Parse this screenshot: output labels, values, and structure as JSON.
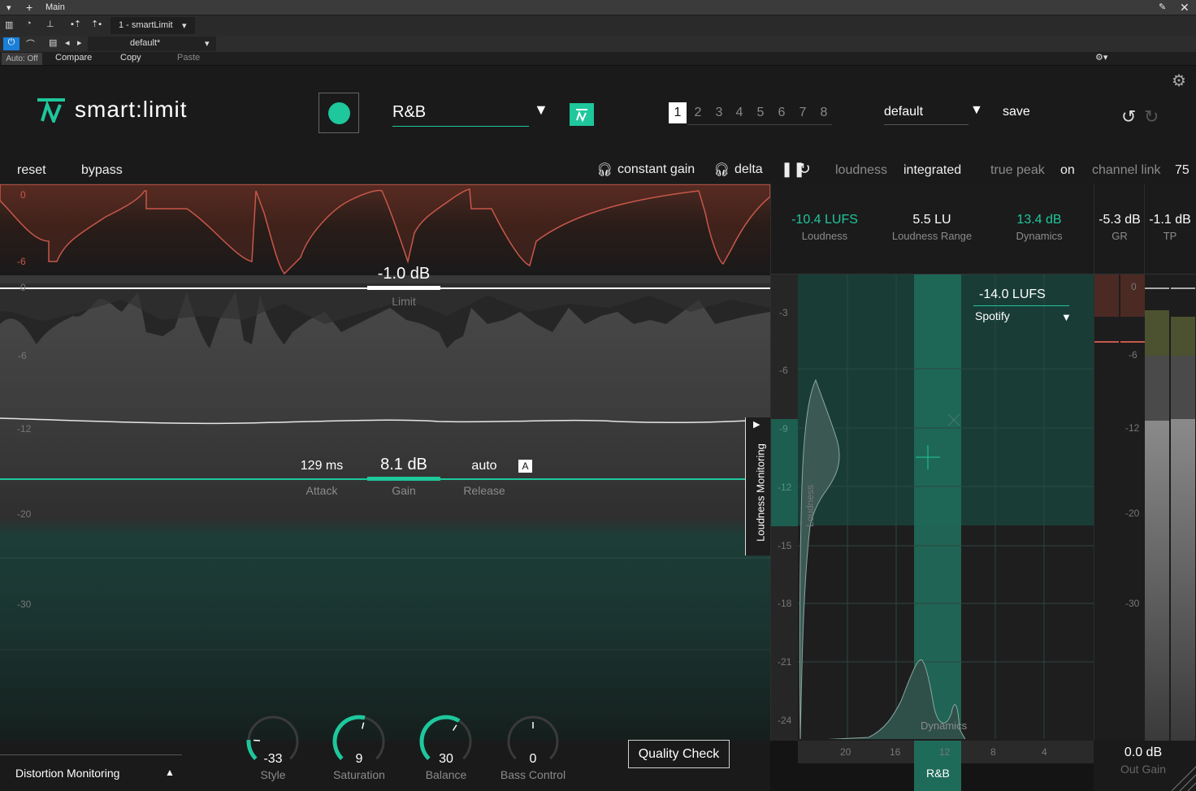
{
  "host": {
    "window_title": "Main",
    "track_label": "1 - smartLimit",
    "preset_name": "default*",
    "auto_label": "Auto: Off",
    "compare_label": "Compare",
    "copy_label": "Copy",
    "paste_label": "Paste"
  },
  "plugin": {
    "logo_text": "smart:limit",
    "profile": "R&B",
    "slots": [
      "1",
      "2",
      "3",
      "4",
      "5",
      "6",
      "7",
      "8"
    ],
    "active_slot": "1",
    "preset": "default",
    "save_label": "save"
  },
  "toolbar": {
    "reset": "reset",
    "bypass": "bypass",
    "constant_gain": "constant gain",
    "delta": "delta",
    "loudness_label": "loudness",
    "loudness_value": "integrated",
    "true_peak_label": "true peak",
    "true_peak_value": "on",
    "channel_link_label": "channel link",
    "channel_link_value": "75"
  },
  "waveform": {
    "gr_scale": [
      "0",
      "-6"
    ],
    "main_scale": [
      "0",
      "-6",
      "-12",
      "-20",
      "-30"
    ],
    "limit_value": "-1.0 dB",
    "limit_label": "Limit",
    "attack_value": "129 ms",
    "attack_label": "Attack",
    "gain_value": "8.1 dB",
    "gain_label": "Gain",
    "release_value": "auto",
    "release_label": "Release",
    "release_auto_badge": "A",
    "loudness_monitoring_tab": "Loudness Monitoring"
  },
  "metrics": {
    "loudness_value": "-10.4 LUFS",
    "loudness_label": "Loudness",
    "range_value": "5.5 LU",
    "range_label": "Loudness Range",
    "dynamics_value": "13.4 dB",
    "dynamics_label": "Dynamics",
    "gr_value": "-5.3 dB",
    "gr_label": "GR",
    "tp_value": "-1.1 dB",
    "tp_label": "TP"
  },
  "loudness_panel": {
    "target_value": "-14.0 LUFS",
    "target_platform": "Spotify",
    "y_scale": [
      "-3",
      "-6",
      "-9",
      "-12",
      "-15",
      "-18",
      "-21",
      "-24"
    ],
    "x_scale": [
      "20",
      "16",
      "12",
      "8",
      "4"
    ],
    "loudness_axis_label": "Loudness",
    "dynamics_axis_label": "Dynamics",
    "profile_tag": "R&B"
  },
  "meters": {
    "scale": [
      "0",
      "-6",
      "-12",
      "-20",
      "-30"
    ],
    "out_gain_value": "0.0 dB",
    "out_gain_label": "Out Gain"
  },
  "bottom": {
    "distortion_monitoring": "Distortion Monitoring",
    "quality_check": "Quality Check",
    "knobs": [
      {
        "value": "-33",
        "label": "Style"
      },
      {
        "value": "9",
        "label": "Saturation"
      },
      {
        "value": "30",
        "label": "Balance"
      },
      {
        "value": "0",
        "label": "Bass Control"
      }
    ]
  },
  "colors": {
    "accent": "#1ec79c",
    "gain_reduction": "#c7574a",
    "background": "#1a1a1a"
  }
}
